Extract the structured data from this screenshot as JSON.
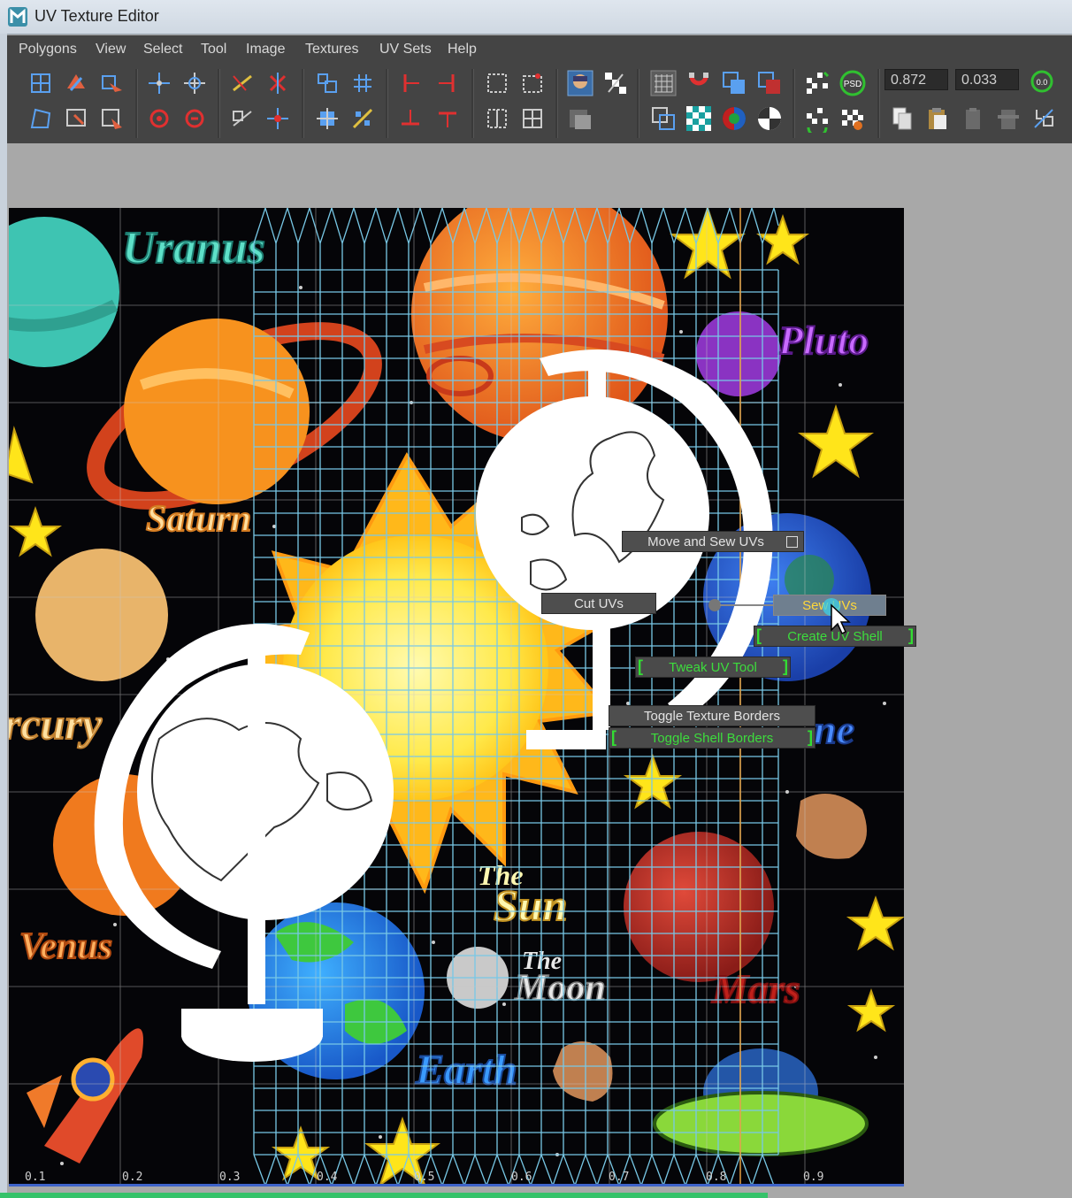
{
  "window": {
    "title": "UV Texture Editor"
  },
  "menubar": {
    "items": [
      "Polygons",
      "View",
      "Select",
      "Tool",
      "Image",
      "Textures",
      "UV Sets",
      "Help"
    ]
  },
  "toolbar": {
    "field_u": "0.872",
    "field_v": "0.033",
    "psd_label": "PSD",
    "zero_label": "0.0"
  },
  "texture_labels": {
    "uranus": "Uranus",
    "pluto": "Pluto",
    "saturn": "Saturn",
    "mercury": "rcury",
    "neptune": "ne",
    "venus": "Venus",
    "the_sun_1": "The",
    "the_sun_2": "Sun",
    "the_moon_1": "The",
    "the_moon_2": "Moon",
    "earth": "Earth",
    "mars": "Mars"
  },
  "marking_menu": {
    "move_and_sew": "Move and Sew UVs",
    "cut_uvs": "Cut UVs",
    "sew_uvs": "Sew UVs",
    "create_uv_shell": "Create UV Shell",
    "tweak_uv_tool": "Tweak UV Tool",
    "toggle_texture_borders": "Toggle Texture Borders",
    "toggle_shell_borders": "Toggle Shell Borders"
  },
  "axis_labels": [
    "0.1",
    "0.2",
    "0.3",
    "0.4",
    "0.5",
    "0.6",
    "0.7",
    "0.8",
    "0.9"
  ],
  "colors": {
    "menubar": "#444444",
    "grid_line": "#78c8e6",
    "text_green": "#3ddc3d",
    "uv_shell": "#ffffff",
    "background": "#a6a6a6"
  }
}
